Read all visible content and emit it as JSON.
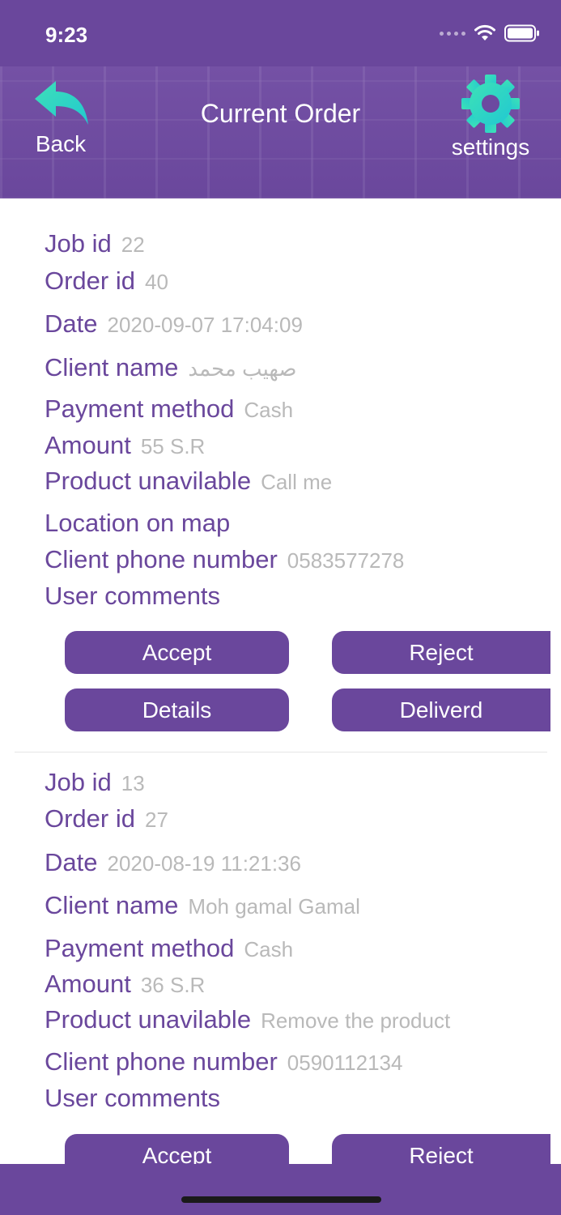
{
  "status_bar": {
    "time": "9:23"
  },
  "nav": {
    "back_label": "Back",
    "title": "Current Order",
    "settings_label": "settings"
  },
  "orders": [
    {
      "job_id_label": "Job id",
      "job_id": "22",
      "order_id_label": "Order id",
      "order_id": "40",
      "date_label": "Date",
      "date": "2020-09-07 17:04:09",
      "client_name_label": "Client name",
      "client_name": "صهيب محمد",
      "payment_method_label": "Payment method",
      "payment_method": "Cash",
      "amount_label": "Amount",
      "amount": "55  S.R",
      "product_unavailable_label": "Product unavilable",
      "product_unavailable": "Call me",
      "location_label": "Location on map",
      "phone_label": "Client phone number",
      "phone": "0583577278",
      "comments_label": "User comments",
      "accept_label": "Accept",
      "reject_label": "Reject",
      "details_label": "Details",
      "delivered_label": "Deliverd"
    },
    {
      "job_id_label": "Job id",
      "job_id": "13",
      "order_id_label": "Order id",
      "order_id": "27",
      "date_label": "Date",
      "date": "2020-08-19 11:21:36",
      "client_name_label": "Client name",
      "client_name": "Moh gamal Gamal",
      "payment_method_label": "Payment method",
      "payment_method": "Cash",
      "amount_label": "Amount",
      "amount": "36  S.R",
      "product_unavailable_label": "Product unavilable",
      "product_unavailable": "Remove the product",
      "phone_label": "Client phone number",
      "phone": "0590112134",
      "comments_label": "User comments",
      "accept_label": "Accept",
      "reject_label": "Reject"
    }
  ],
  "colors": {
    "primary": "#6a479c",
    "accent": "#2fd3c0",
    "value_gray": "#b9b9b9"
  },
  "icons": {
    "back": "back-arrow-icon",
    "settings": "gear-icon",
    "wifi": "wifi-icon",
    "battery": "battery-icon",
    "signal": "signal-dots-icon"
  }
}
